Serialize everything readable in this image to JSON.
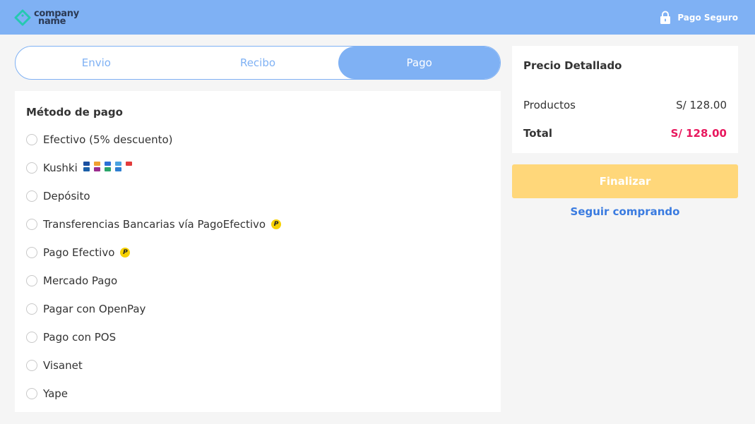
{
  "brand": {
    "logo_line1": "company",
    "logo_line2": "name",
    "accent_color": "#7fb1f4"
  },
  "header": {
    "secure_label": "Pago Seguro",
    "secure_icon": "lock-icon"
  },
  "steps": {
    "tabs": [
      {
        "label": "Envio",
        "active": false
      },
      {
        "label": "Recibo",
        "active": false
      },
      {
        "label": "Pago",
        "active": true
      }
    ]
  },
  "payment": {
    "title": "Método de pago",
    "methods": [
      {
        "label": "Efectivo (5% descuento)",
        "icon": null
      },
      {
        "label": "Kushki",
        "icon": "card-brands-icon"
      },
      {
        "label": "Depósito",
        "icon": null
      },
      {
        "label": "Transferencias Bancarias vía PagoEfectivo",
        "icon": "pagoefectivo-icon"
      },
      {
        "label": "Pago Efectivo",
        "icon": "pagoefectivo-icon"
      },
      {
        "label": "Mercado Pago",
        "icon": null
      },
      {
        "label": "Pagar con OpenPay",
        "icon": null
      },
      {
        "label": "Pago con POS",
        "icon": null
      },
      {
        "label": "Visanet",
        "icon": null
      },
      {
        "label": "Yape",
        "icon": null
      }
    ]
  },
  "summary": {
    "title": "Precio Detallado",
    "products_label": "Productos",
    "products_value": "S/ 128.00",
    "total_label": "Total",
    "total_value": "S/ 128.00",
    "total_color": "#e8175d"
  },
  "actions": {
    "finalize_label": "Finalizar",
    "finalize_color": "#ffd77a",
    "continue_label": "Seguir comprando",
    "continue_color": "#3a7be0"
  }
}
